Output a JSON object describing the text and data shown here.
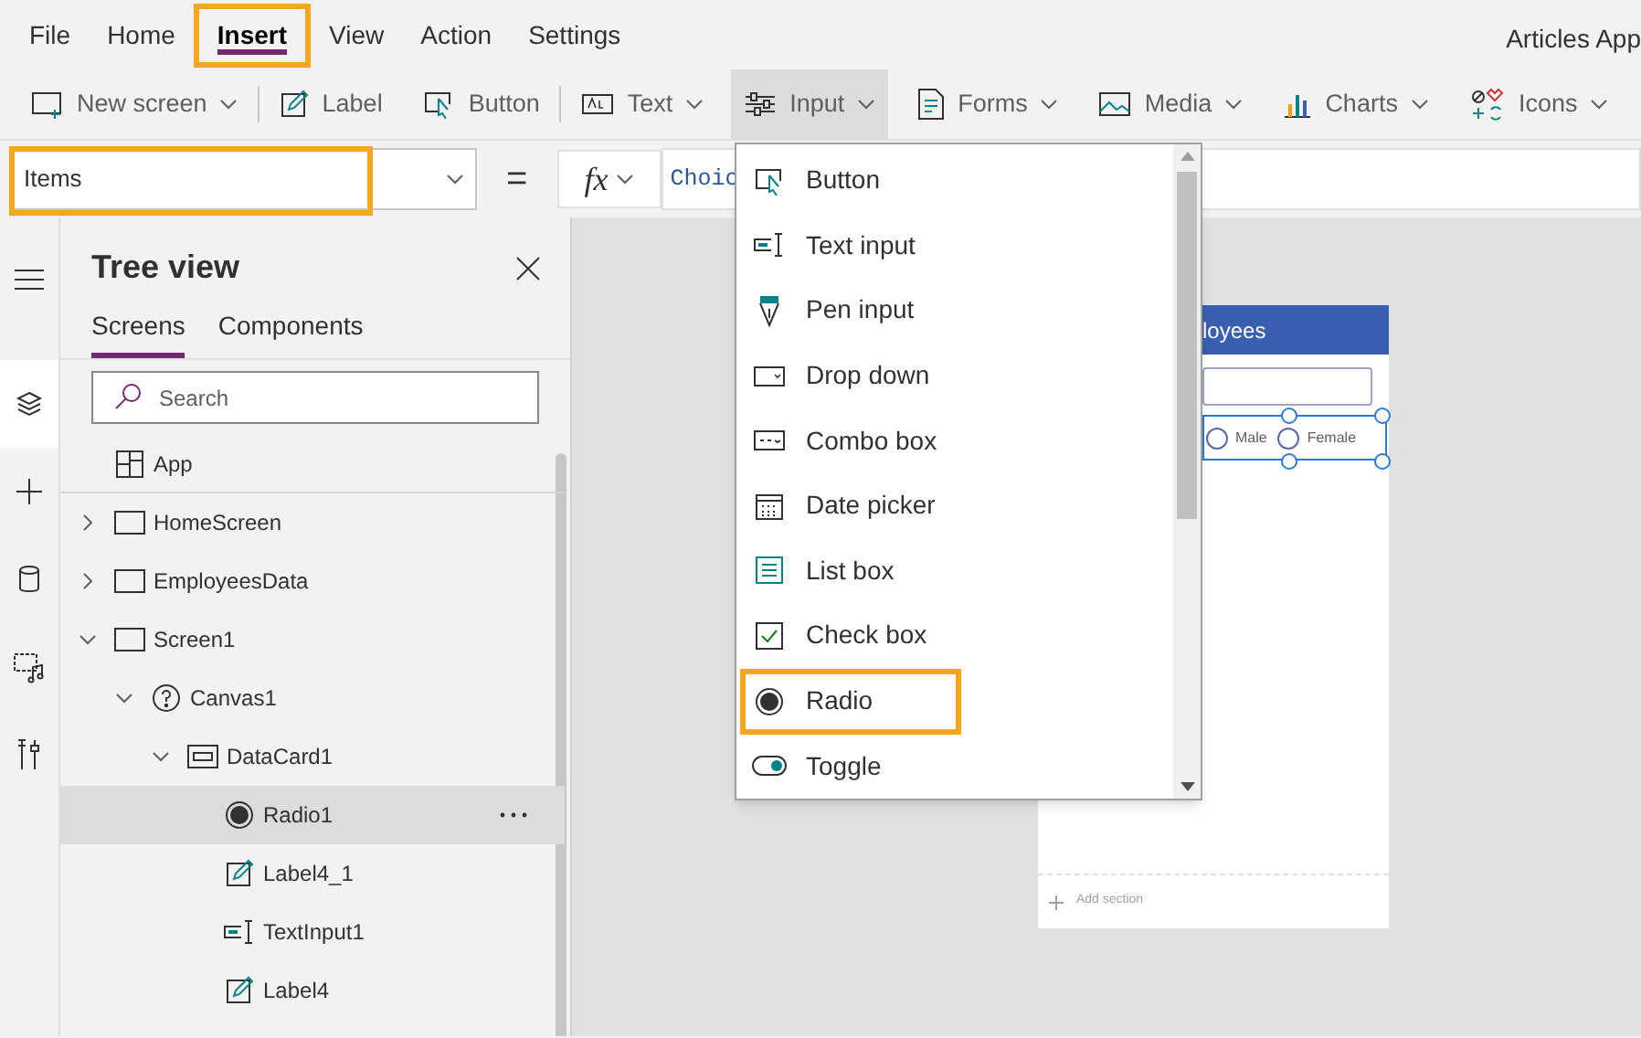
{
  "menu_bar": {
    "items": [
      {
        "label": "File",
        "selected": false,
        "highlighted": false
      },
      {
        "label": "Home",
        "selected": false,
        "highlighted": false
      },
      {
        "label": "Insert",
        "selected": true,
        "highlighted": true
      },
      {
        "label": "View",
        "selected": false,
        "highlighted": false
      },
      {
        "label": "Action",
        "selected": false,
        "highlighted": false
      },
      {
        "label": "Settings",
        "selected": false,
        "highlighted": false
      }
    ],
    "app_title": "Articles App"
  },
  "toolbar": {
    "items": [
      {
        "label": "New screen",
        "active": false
      },
      {
        "label": "Label",
        "active": false
      },
      {
        "label": "Button",
        "active": false
      },
      {
        "label": "Text",
        "active": false
      },
      {
        "label": "Input",
        "active": true
      },
      {
        "label": "Forms",
        "active": false
      },
      {
        "label": "Media",
        "active": false
      },
      {
        "label": "Charts",
        "active": false
      },
      {
        "label": "Icons",
        "active": false
      }
    ]
  },
  "formula_bar": {
    "property": "Items",
    "highlighted": true,
    "equals": "=",
    "fx": "fx",
    "formula": "Choic"
  },
  "left_rail": [
    {
      "selected": false
    },
    {
      "selected": true
    },
    {
      "selected": false
    },
    {
      "selected": false
    },
    {
      "selected": false
    },
    {
      "selected": false
    }
  ],
  "tree_view": {
    "title": "Tree view",
    "tabs": [
      {
        "label": "Screens",
        "selected": true
      },
      {
        "label": "Components",
        "selected": false
      }
    ],
    "search": {
      "placeholder": "Search"
    },
    "items": [
      {
        "label": "App",
        "kind": "app",
        "selected": false
      },
      {
        "label": "HomeScreen",
        "kind": "screen",
        "expanded": false,
        "selected": false
      },
      {
        "label": "EmployeesData",
        "kind": "screen",
        "expanded": false,
        "selected": false
      },
      {
        "label": "Screen1",
        "kind": "screen",
        "expanded": true,
        "selected": false,
        "children": [
          {
            "label": "Canvas1",
            "kind": "canvas",
            "expanded": true,
            "selected": false,
            "children": [
              {
                "label": "DataCard1",
                "kind": "card",
                "expanded": true,
                "selected": false,
                "children": [
                  {
                    "label": "Radio1",
                    "kind": "radio",
                    "selected": true
                  },
                  {
                    "label": "Label4_1",
                    "kind": "label",
                    "selected": false
                  },
                  {
                    "label": "TextInput1",
                    "kind": "textinput",
                    "selected": false
                  },
                  {
                    "label": "Label4",
                    "kind": "label",
                    "selected": false
                  }
                ]
              }
            ]
          }
        ]
      }
    ]
  },
  "input_menu": {
    "items": [
      {
        "label": "Button",
        "highlighted": false
      },
      {
        "label": "Text input",
        "highlighted": false
      },
      {
        "label": "Pen input",
        "highlighted": false
      },
      {
        "label": "Drop down",
        "highlighted": false
      },
      {
        "label": "Combo box",
        "highlighted": false
      },
      {
        "label": "Date picker",
        "highlighted": false
      },
      {
        "label": "List box",
        "highlighted": false
      },
      {
        "label": "Check box",
        "highlighted": false
      },
      {
        "label": "Radio",
        "highlighted": true
      },
      {
        "label": "Toggle",
        "highlighted": false
      }
    ]
  },
  "canvas": {
    "header": "loyees",
    "radio_options": [
      {
        "label": "Male",
        "selected": false
      },
      {
        "label": "Female",
        "selected": false
      }
    ],
    "add_section": "Add section"
  }
}
